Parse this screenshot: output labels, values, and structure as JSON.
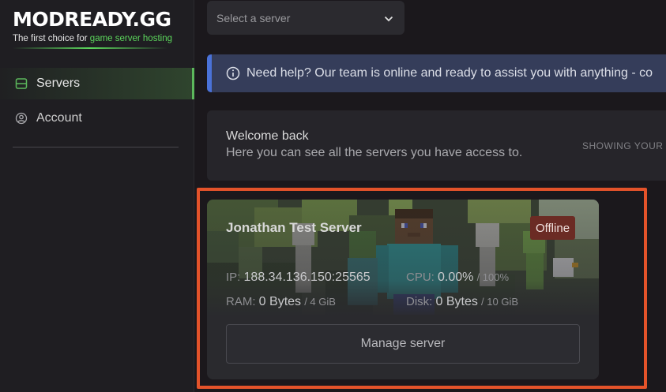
{
  "brand": {
    "name_main": "MODREADY",
    "name_suffix": ".GG",
    "tagline_prefix": "The first choice for ",
    "tagline_accent": "game server hosting",
    "accent_color": "#5cd65c"
  },
  "sidebar": {
    "items": [
      {
        "label": "Servers",
        "icon": "server-icon",
        "active": true
      },
      {
        "label": "Account",
        "icon": "user-circle-icon",
        "active": false
      }
    ]
  },
  "server_select": {
    "placeholder": "Select a server",
    "icon": "chevron-down-icon"
  },
  "info_banner": {
    "icon": "info-icon",
    "text": "Need help? Our team is online and ready to assist you with anything - co"
  },
  "welcome": {
    "title": "Welcome back",
    "subtitle": "Here you can see all the servers you have access to.",
    "showing_text": "SHOWING YOUR S"
  },
  "server_card": {
    "name": "Jonathan Test Server",
    "status": "Offline",
    "status_color": "#6b2b24",
    "ip_label": "IP:",
    "ip_value": "188.34.136.150:25565",
    "cpu_label": "CPU:",
    "cpu_value": "0.00%",
    "cpu_max": "/ 100%",
    "ram_label": "RAM:",
    "ram_value": "0 Bytes",
    "ram_max": "/ 4 GiB",
    "disk_label": "Disk:",
    "disk_value": "0 Bytes",
    "disk_max": "/ 10 GiB",
    "manage_label": "Manage server"
  },
  "highlight_color": "#e4532a"
}
